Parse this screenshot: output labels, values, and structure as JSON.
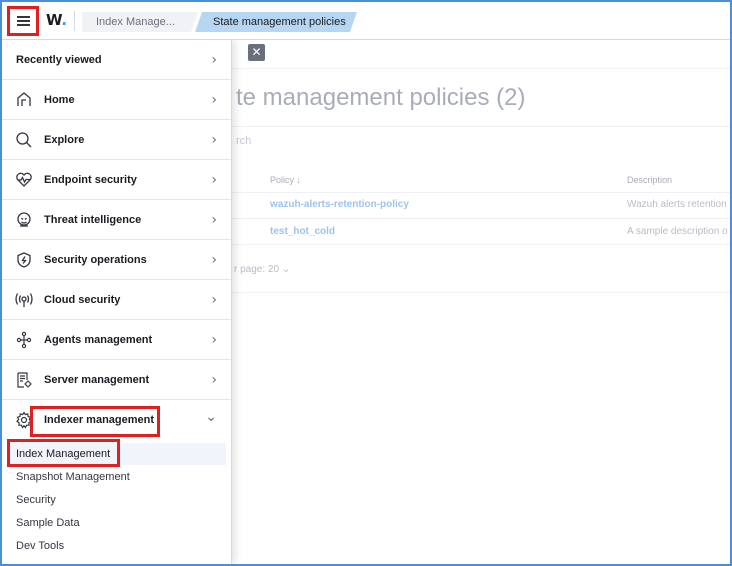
{
  "header": {
    "logo_text": "W",
    "logo_dot": ".",
    "breadcrumbs": [
      {
        "label": "Index Manage..."
      },
      {
        "label": "State management policies"
      }
    ]
  },
  "page": {
    "title": "te management policies (2)",
    "search_placeholder": "rch",
    "columns": {
      "policy": "Policy ↓",
      "description": "Description"
    },
    "policies": [
      {
        "name": "wazuh-alerts-retention-policy",
        "description": "Wazuh alerts retention"
      },
      {
        "name": "test_hot_cold",
        "description": "A sample description o"
      }
    ],
    "rows_per_page": "r page: 20 ⌄",
    "close_symbol": "✕"
  },
  "sidenav": {
    "recently_viewed": "Recently viewed",
    "items": [
      {
        "label": "Home",
        "icon": "home-icon"
      },
      {
        "label": "Explore",
        "icon": "search-icon"
      },
      {
        "label": "Endpoint security",
        "icon": "heartbeat-icon"
      },
      {
        "label": "Threat intelligence",
        "icon": "threat-icon"
      },
      {
        "label": "Security operations",
        "icon": "shield-icon"
      },
      {
        "label": "Cloud security",
        "icon": "antenna-icon"
      },
      {
        "label": "Agents management",
        "icon": "nodes-icon"
      },
      {
        "label": "Server management",
        "icon": "document-gear-icon"
      },
      {
        "label": "Indexer management",
        "icon": "gear-icon"
      }
    ],
    "chevron_right": "›",
    "chevron_down": "⌄",
    "subitems": [
      {
        "label": "Index Management",
        "active": true
      },
      {
        "label": "Snapshot Management"
      },
      {
        "label": "Security"
      },
      {
        "label": "Sample Data"
      },
      {
        "label": "Dev Tools"
      }
    ]
  },
  "colors": {
    "highlight": "#e02020",
    "frame": "#4a90d9",
    "breadcrumb_active": "#b6d6f2",
    "link": "#9cc3ec"
  }
}
